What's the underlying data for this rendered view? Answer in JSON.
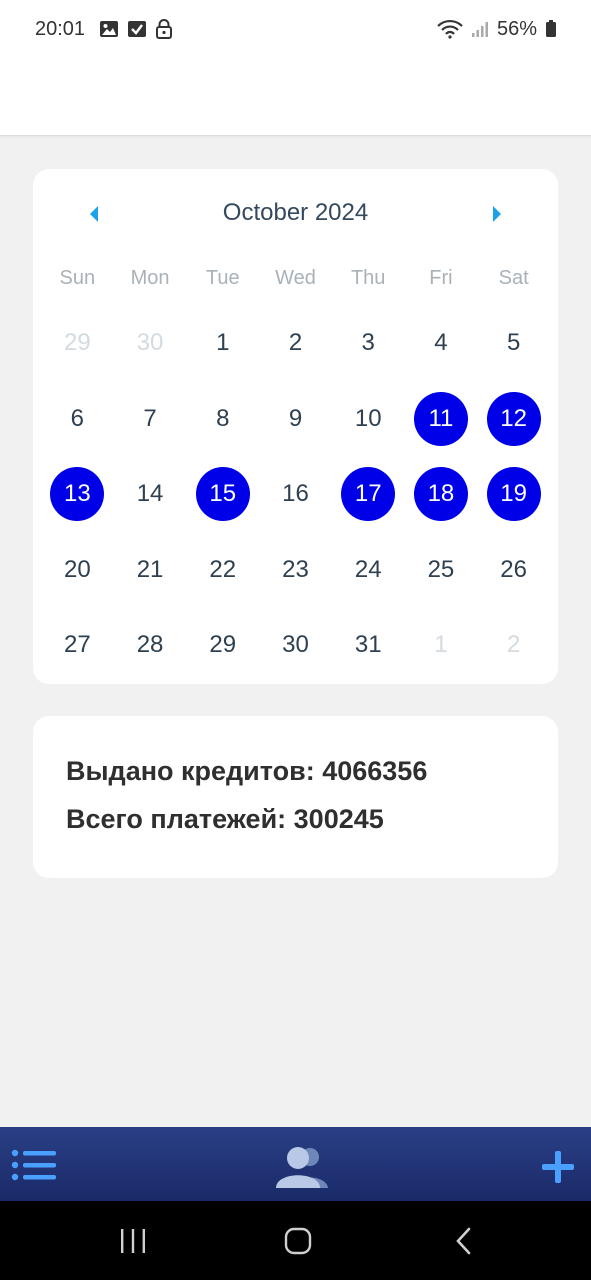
{
  "status_bar": {
    "time": "20:01",
    "battery": "56%"
  },
  "calendar": {
    "month_title": "October 2024",
    "weekdays": [
      "Sun",
      "Mon",
      "Tue",
      "Wed",
      "Thu",
      "Fri",
      "Sat"
    ],
    "weeks": [
      [
        {
          "d": "29",
          "other": true
        },
        {
          "d": "30",
          "other": true
        },
        {
          "d": "1"
        },
        {
          "d": "2"
        },
        {
          "d": "3"
        },
        {
          "d": "4"
        },
        {
          "d": "5"
        }
      ],
      [
        {
          "d": "6"
        },
        {
          "d": "7"
        },
        {
          "d": "8"
        },
        {
          "d": "9"
        },
        {
          "d": "10"
        },
        {
          "d": "11",
          "marked": true
        },
        {
          "d": "12",
          "marked": true
        }
      ],
      [
        {
          "d": "13",
          "marked": true
        },
        {
          "d": "14"
        },
        {
          "d": "15",
          "marked": true
        },
        {
          "d": "16"
        },
        {
          "d": "17",
          "marked": true
        },
        {
          "d": "18",
          "marked": true
        },
        {
          "d": "19",
          "marked": true
        }
      ],
      [
        {
          "d": "20"
        },
        {
          "d": "21"
        },
        {
          "d": "22"
        },
        {
          "d": "23"
        },
        {
          "d": "24"
        },
        {
          "d": "25"
        },
        {
          "d": "26"
        }
      ],
      [
        {
          "d": "27"
        },
        {
          "d": "28"
        },
        {
          "d": "29"
        },
        {
          "d": "30"
        },
        {
          "d": "31"
        },
        {
          "d": "1",
          "other": true
        },
        {
          "d": "2",
          "other": true
        }
      ]
    ],
    "accent_color": "#0000e8",
    "nav_color": "#1aa3e8"
  },
  "stats": {
    "credits_issued": "Выдано кредитов: 4066356",
    "total_payments": "Всего платежей: 300245"
  },
  "bottom_nav": {
    "icons": [
      "menu-list-icon",
      "users-icon",
      "plus-icon"
    ]
  }
}
